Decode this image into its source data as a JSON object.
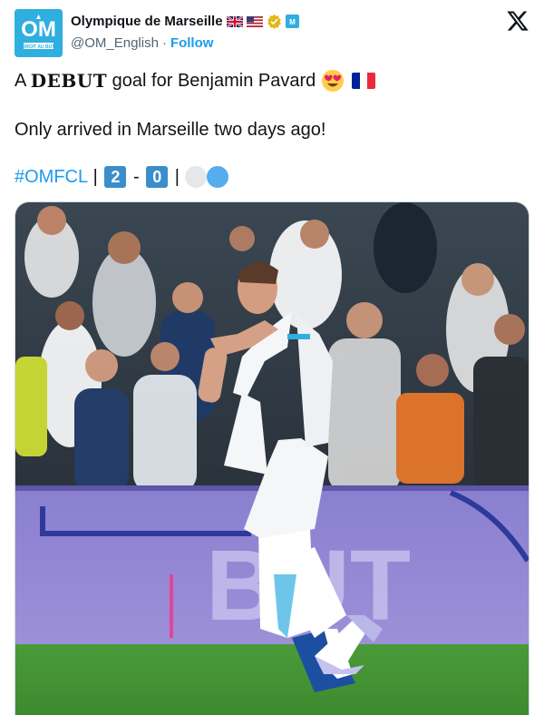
{
  "account": {
    "display_name": "Olympique de Marseille",
    "handle": "@OM_English",
    "separator": "·",
    "follow_label": "Follow",
    "avatar_text": "DROIT AU BUT"
  },
  "icons": {
    "flag_uk": "uk-flag-icon",
    "flag_us": "us-flag-icon",
    "verified": "verified-badge-icon",
    "affiliate": "om-affiliate-icon",
    "platform": "x-logo-icon",
    "emoji_heart_eyes": "heart-eyes-emoji-icon",
    "emoji_france": "france-flag-emoji-icon"
  },
  "tweet": {
    "line1_prefix": "A ",
    "line1_bold": "DEBUT",
    "line1_suffix": " goal for Benjamin Pavard",
    "line2": "Only arrived in Marseille two days ago!",
    "hashtag": "#OMFCL",
    "sep1": " | ",
    "score_home": "2",
    "score_dash": " - ",
    "score_away": "0",
    "sep2": " | "
  },
  "media": {
    "description": "photo",
    "board_text": "BUT"
  },
  "colors": {
    "accent": "#1d9bf0",
    "om_blue": "#2faee0",
    "score_box": "#3a8ec9"
  }
}
